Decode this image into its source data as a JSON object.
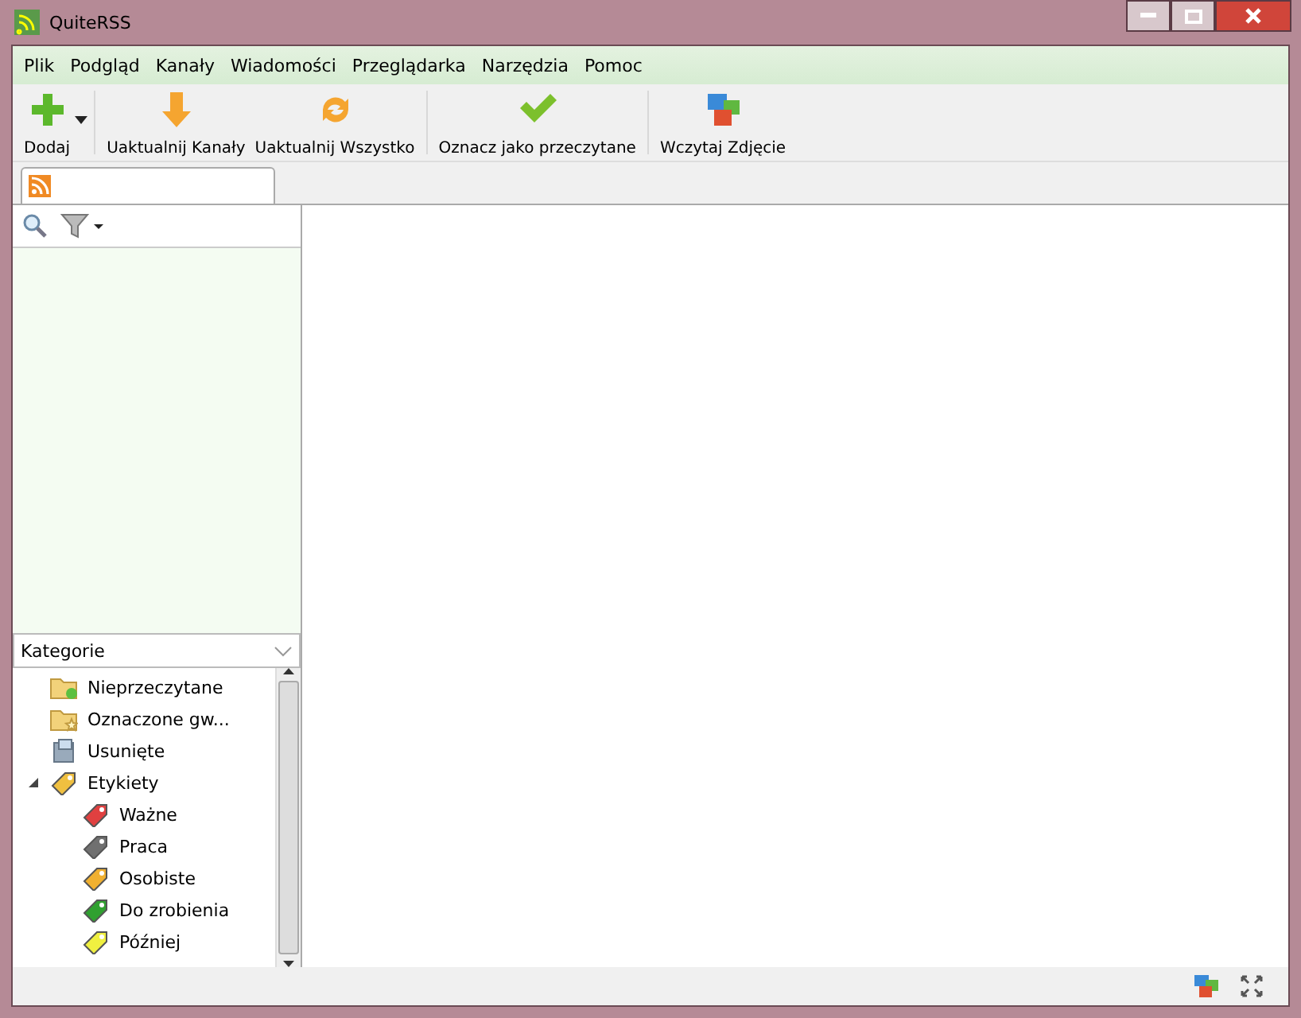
{
  "window": {
    "title": "QuiteRSS"
  },
  "menu": [
    "Plik",
    "Podgląd",
    "Kanały",
    "Wiadomości",
    "Przeglądarka",
    "Narzędzia",
    "Pomoc"
  ],
  "toolbar": [
    {
      "kind": "add",
      "label": "Dodaj"
    },
    {
      "kind": "update",
      "label": "Uaktualnij Kanały"
    },
    {
      "kind": "updateall",
      "label": "Uaktualnij Wszystko"
    },
    {
      "kind": "markread",
      "label": "Oznacz jako przeczytane"
    },
    {
      "kind": "image",
      "label": "Wczytaj Zdjęcie"
    }
  ],
  "tabs": [
    {
      "kind": "feeds",
      "selected": true
    }
  ],
  "categories": {
    "title": "Kategorie",
    "items": [
      {
        "kind": "unread",
        "label": "Nieprzeczytane"
      },
      {
        "kind": "starred",
        "label": "Oznaczone gw..."
      },
      {
        "kind": "deleted",
        "label": "Usunięte"
      },
      {
        "kind": "labels",
        "label": "Etykiety",
        "expanded": true,
        "children": [
          {
            "label": "Ważne",
            "color": "#e04040"
          },
          {
            "label": "Praca",
            "color": "#707070"
          },
          {
            "label": "Osobiste",
            "color": "#f0b030"
          },
          {
            "label": "Do zrobienia",
            "color": "#30a030"
          },
          {
            "label": "Później",
            "color": "#f0f040"
          }
        ]
      }
    ]
  }
}
